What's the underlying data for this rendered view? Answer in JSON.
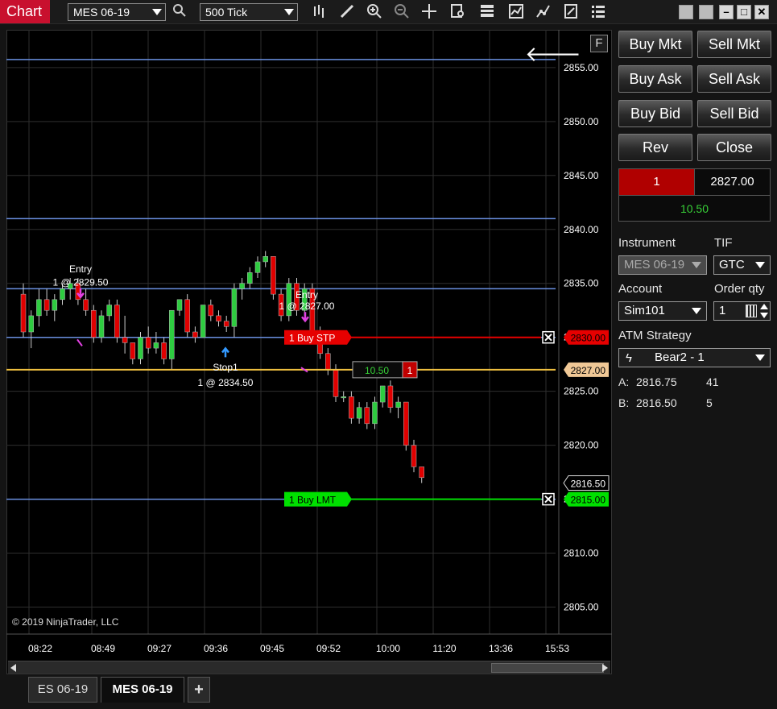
{
  "app": {
    "title": "Chart"
  },
  "toolbar": {
    "instrument": "MES 06-19",
    "interval": "500 Tick",
    "icons": [
      "bar-type-icon",
      "draw-tool-icon",
      "zoom-in-icon",
      "zoom-out-icon",
      "crosshair-icon",
      "data-box-icon",
      "properties-icon",
      "indicators-icon",
      "strategies-icon",
      "templates-icon",
      "chart-trader-icon"
    ]
  },
  "chart": {
    "f_button": "F",
    "copyright": "© 2019 NinjaTrader, LLC",
    "price_labels": [
      "2855.00",
      "2850.00",
      "2845.00",
      "2840.00",
      "2835.00",
      "2830.00",
      "2825.00",
      "2820.00",
      "2815.00",
      "2810.00",
      "2805.00"
    ],
    "time_labels": [
      "08:22",
      "08:49",
      "09:27",
      "09:36",
      "09:45",
      "09:52",
      "10:00",
      "11:20",
      "13:36",
      "15:53"
    ],
    "orders": [
      {
        "label": "1  Buy STP",
        "price": "2830.00",
        "color": "#e60000"
      },
      {
        "label": "1  Buy LMT",
        "price": "2815.00",
        "color": "#00e000"
      }
    ],
    "position": {
      "pnl": "10.50",
      "qty": "1",
      "price": "2827.00"
    },
    "last_price": "2816.50",
    "annotations": [
      {
        "text": "Entry",
        "sub": "1 @ 2829.50"
      },
      {
        "text": "Entry",
        "sub": "1 @ 2827.00"
      },
      {
        "text": "Stop1",
        "sub": "1 @ 2834.50"
      }
    ]
  },
  "tabs": [
    {
      "label": "ES 06-19",
      "active": false
    },
    {
      "label": "MES 06-19",
      "active": true
    },
    {
      "label": "+",
      "active": false
    }
  ],
  "trader": {
    "buttons": {
      "buy_mkt": "Buy Mkt",
      "sell_mkt": "Sell Mkt",
      "buy_ask": "Buy Ask",
      "sell_ask": "Sell Ask",
      "buy_bid": "Buy Bid",
      "sell_bid": "Sell Bid",
      "rev": "Rev",
      "close": "Close"
    },
    "position": {
      "qty": "1",
      "avg_price": "2827.00",
      "pnl": "10.50"
    },
    "instrument_label": "Instrument",
    "instrument": "MES 06-19",
    "tif_label": "TIF",
    "tif": "GTC",
    "account_label": "Account",
    "account": "Sim101",
    "order_qty_label": "Order qty",
    "order_qty": "1",
    "atm_label": "ATM Strategy",
    "atm": "Bear2 - 1",
    "ask_label": "A:",
    "ask_price": "2816.75",
    "ask_size": "41",
    "bid_label": "B:",
    "bid_price": "2816.50",
    "bid_size": "5"
  },
  "colors": {
    "brand": "#c8102e",
    "up_candle": "#2ecc40",
    "down_candle": "#e00000",
    "stop_order": "#e60000",
    "limit_order": "#00e000",
    "position_line": "#f0c040",
    "level_line": "#6a8fe0"
  },
  "chart_data": {
    "type": "candlestick",
    "ylim": [
      2802.5,
      2858.5
    ],
    "levels": [
      2855.75,
      2841.0,
      2834.5,
      2830.0,
      2815.0
    ],
    "candles": [
      [
        2834,
        2835,
        2830,
        2830.5
      ],
      [
        2830.5,
        2832.5,
        2829,
        2832
      ],
      [
        2832,
        2834.5,
        2831,
        2833.5
      ],
      [
        2833.5,
        2834.5,
        2832,
        2832.5
      ],
      [
        2832.5,
        2834,
        2831.5,
        2833.5
      ],
      [
        2833.5,
        2835,
        2833,
        2834.5
      ],
      [
        2834.5,
        2835.5,
        2833.5,
        2835
      ],
      [
        2835,
        2835.5,
        2833,
        2833.5
      ],
      [
        2833.5,
        2834.5,
        2832,
        2832.5
      ],
      [
        2832.5,
        2833,
        2829.5,
        2830
      ],
      [
        2830,
        2832.5,
        2829.5,
        2832
      ],
      [
        2832,
        2833.5,
        2831.5,
        2833
      ],
      [
        2833,
        2833.5,
        2829.5,
        2830
      ],
      [
        2830,
        2832,
        2828.5,
        2829.5
      ],
      [
        2829.5,
        2829.5,
        2827.5,
        2828
      ],
      [
        2828,
        2830.5,
        2827.5,
        2830
      ],
      [
        2830,
        2831,
        2828.5,
        2829
      ],
      [
        2829,
        2830.5,
        2828.5,
        2829.5
      ],
      [
        2829.5,
        2830,
        2827.5,
        2828
      ],
      [
        2828,
        2832.5,
        2827,
        2832.5
      ],
      [
        2832.5,
        2833.5,
        2832,
        2833.5
      ],
      [
        2833.5,
        2834,
        2830,
        2830.5
      ],
      [
        2830.5,
        2831,
        2829.5,
        2830
      ],
      [
        2830,
        2833,
        2830,
        2833
      ],
      [
        2833,
        2833.5,
        2831.5,
        2832
      ],
      [
        2832,
        2832.5,
        2831,
        2831.5
      ],
      [
        2831.5,
        2832,
        2830.5,
        2831
      ],
      [
        2831,
        2835,
        2830,
        2834.5
      ],
      [
        2834.5,
        2835.5,
        2833.5,
        2835
      ],
      [
        2835,
        2836.5,
        2834.5,
        2836
      ],
      [
        2836,
        2837.5,
        2835.5,
        2837
      ],
      [
        2837,
        2838,
        2836.5,
        2837.5
      ],
      [
        2837.5,
        2837.5,
        2833.5,
        2834
      ],
      [
        2834,
        2834.5,
        2831.5,
        2832
      ],
      [
        2832,
        2835.5,
        2831.5,
        2835
      ],
      [
        2835,
        2835.5,
        2832,
        2832.5
      ],
      [
        2832.5,
        2835,
        2832,
        2834.5
      ],
      [
        2834.5,
        2835,
        2830,
        2830.5
      ],
      [
        2830.5,
        2831,
        2828,
        2828.5
      ],
      [
        2828.5,
        2829,
        2826.5,
        2827
      ],
      [
        2827,
        2827.5,
        2824,
        2824.5
      ],
      [
        2824.5,
        2825,
        2824,
        2824.5
      ],
      [
        2824.5,
        2825,
        2822,
        2822.5
      ],
      [
        2822.5,
        2824,
        2822,
        2823.5
      ],
      [
        2823.5,
        2824,
        2821.5,
        2822
      ],
      [
        2822,
        2824.5,
        2821.5,
        2824
      ],
      [
        2824,
        2825.5,
        2823.5,
        2825.5
      ],
      [
        2825.5,
        2826,
        2823,
        2823.5
      ],
      [
        2823.5,
        2824.5,
        2822.5,
        2824
      ],
      [
        2824,
        2824,
        2819.5,
        2820
      ],
      [
        2820,
        2820.5,
        2817.5,
        2818
      ],
      [
        2818,
        2818,
        2816.5,
        2817
      ]
    ]
  }
}
